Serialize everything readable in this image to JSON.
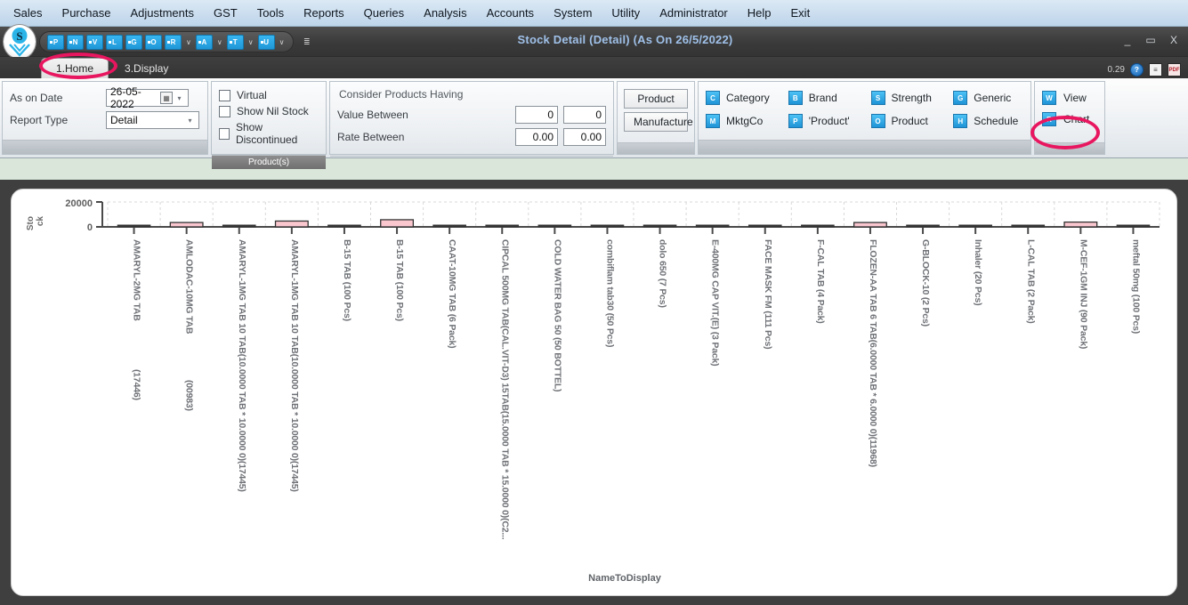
{
  "menu": {
    "items": [
      "Sales",
      "Purchase",
      "Adjustments",
      "GST",
      "Tools",
      "Reports",
      "Queries",
      "Analysis",
      "Accounts",
      "System",
      "Utility",
      "Administrator",
      "Help",
      "Exit"
    ]
  },
  "window": {
    "title": "Stock Detail (Detail)  (As On 26/5/2022)",
    "minimize": "_",
    "maximize": "▭",
    "close": "X",
    "version_value": "0.29",
    "help_icon": "?",
    "doc_icon": "≡",
    "pdf_icon": "PDF"
  },
  "quick_toolbar": {
    "buttons": [
      "P",
      "N",
      "V",
      "L",
      "G",
      "O",
      "R",
      "A",
      "T",
      "U"
    ],
    "caret": "∨",
    "overflow": "☰"
  },
  "tabs": [
    {
      "label": "1.Home",
      "active": true
    },
    {
      "label": "3.Display",
      "active": false
    }
  ],
  "ribbon": {
    "filters": {
      "as_on_date_label": "As on Date",
      "as_on_date_value": "26-05-2022",
      "report_type_label": "Report Type",
      "report_type_value": "Detail",
      "calendar_icon": "▦",
      "dropdown_caret": "▾",
      "caption": ""
    },
    "products": {
      "caption": "Product(s)",
      "checkboxes": [
        {
          "label": "Virtual",
          "checked": false
        },
        {
          "label": "Show Nil Stock",
          "checked": false
        },
        {
          "label": "Show Discontinued",
          "checked": false
        }
      ]
    },
    "consider": {
      "title": "Consider Products Having",
      "value_between_label": "Value Between",
      "value_between_from": "0",
      "value_between_to": "0",
      "rate_between_label": "Rate Between",
      "rate_between_from": "0.00",
      "rate_between_to": "0.00"
    },
    "selection": {
      "buttons": [
        "Product",
        "Manufacture"
      ]
    },
    "grouping": {
      "items": [
        {
          "label": "Category",
          "icon": "C"
        },
        {
          "label": "Brand",
          "icon": "B"
        },
        {
          "label": "Strength",
          "icon": "S"
        },
        {
          "label": "Generic",
          "icon": "G"
        },
        {
          "label": "MktgCo",
          "icon": "M"
        },
        {
          "label": "'Product'",
          "icon": "P"
        },
        {
          "label": "Product",
          "icon": "O"
        },
        {
          "label": "Schedule",
          "icon": "H"
        }
      ]
    },
    "output": {
      "items": [
        {
          "label": "View",
          "icon": "W"
        },
        {
          "label": "Chart",
          "icon": "R"
        }
      ]
    }
  },
  "highlights": [
    {
      "name": "home-tab-highlight"
    },
    {
      "name": "chart-button-highlight"
    }
  ],
  "chart_data": {
    "type": "bar",
    "title": "",
    "xlabel": "NameToDisplay",
    "ylabel": "Stock",
    "ylim": [
      0,
      24000
    ],
    "yticks": [
      0,
      20000
    ],
    "ytick_labels": [
      "0",
      "20000"
    ],
    "grid": true,
    "bar_color": "#fbc7cf",
    "bar_edge_color": "#333333",
    "categories": [
      "AMARYL-2MG TAB\n\n(17446)",
      "AMLODAC-10MG TAB\n\n(00983)",
      "AMARYL-1MG TAB 10 TAB(10.0000 TAB * 10.0000 0)(17445)",
      "AMARYL-1MG TAB 10 TAB(10.0000 TAB * 10.0000 0)(17445)",
      "B-15 TAB (100 Pcs)",
      "B-15 TAB (100 Pcs)",
      "CAAT-10MG TAB (6 Pack)",
      "CIPCAL 500MG TAB(CAL.VIT-D3) 15TAB(15.0000 TAB * 15.0000 0)(C2...",
      "COLD WATER BAG 50 (50 BOTTEL)",
      "combiflam tab30 (50 Pcs)",
      "dolo 650 (7 Pcs)",
      "E-400MG CAP VIT.(E) (3 Pack)",
      "FACE MASK FM (111 Pcs)",
      "F-CAL TAB (4 Pack)",
      "FLOZEN-AA TAB 6 TAB(6.0000 TAB * 6.0000 0)(11968)",
      "G-BLOCK-10 (2 Pcs)",
      "Inhaler (20 Pcs)",
      "L-CAL TAB (2 Pack)",
      "M-CEF-1GM INJ (90 Pack)",
      "meftal 50mg (100 Pcs)"
    ],
    "values": [
      0,
      4200,
      0,
      5600,
      0,
      6900,
      0,
      0,
      0,
      0,
      0,
      0,
      0,
      0,
      4200,
      0,
      0,
      0,
      4600,
      0
    ],
    "series": [
      {
        "name": "Stock",
        "values": [
          0,
          4200,
          0,
          5600,
          0,
          6900,
          0,
          0,
          0,
          0,
          0,
          0,
          0,
          0,
          4200,
          0,
          0,
          0,
          4600,
          0
        ]
      }
    ]
  }
}
